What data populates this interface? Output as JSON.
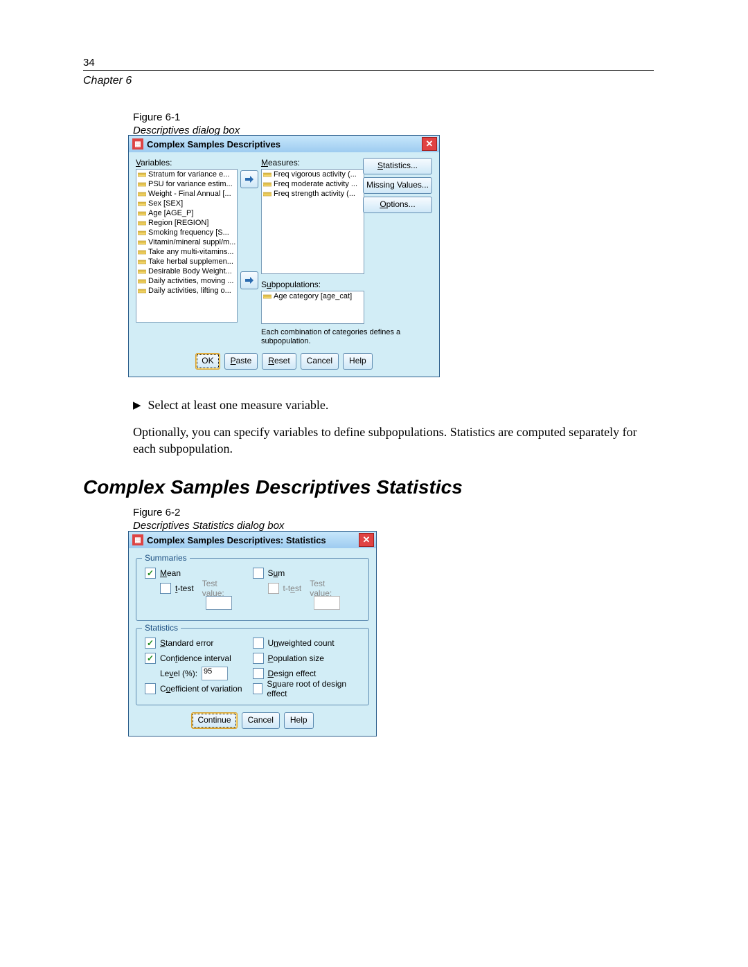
{
  "page_number": "34",
  "chapter": "Chapter 6",
  "figure1": {
    "label": "Figure 6-1",
    "caption": "Descriptives dialog box"
  },
  "dialog1": {
    "title": "Complex Samples Descriptives",
    "labels": {
      "variables": "Variables:",
      "measures": "Measures:",
      "subpop": "Subpopulations:"
    },
    "variables": [
      "Stratum for variance e...",
      "PSU for variance estim...",
      "Weight - Final Annual [...",
      "Sex [SEX]",
      "Age [AGE_P]",
      "Region [REGION]",
      "Smoking frequency [S...",
      "Vitamin/mineral suppl/m...",
      "Take any multi-vitamins...",
      "Take herbal supplemen...",
      "Desirable Body Weight...",
      "Daily activities, moving ...",
      "Daily activities, lifting o..."
    ],
    "measures": [
      "Freq vigorous activity (...",
      "Freq moderate activity ...",
      "Freq strength activity (..."
    ],
    "subpop": [
      "Age category [age_cat]"
    ],
    "side_buttons": {
      "stats": "Statistics...",
      "missing": "Missing Values...",
      "options": "Options..."
    },
    "hint": "Each combination of categories defines a subpopulation.",
    "buttons": {
      "ok": "OK",
      "paste": "Paste",
      "reset": "Reset",
      "cancel": "Cancel",
      "help": "Help"
    }
  },
  "body": {
    "bullet": "Select at least one measure variable.",
    "para": "Optionally, you can specify variables to define subpopulations. Statistics are computed separately for each subpopulation."
  },
  "heading": "Complex Samples Descriptives Statistics",
  "figure2": {
    "label": "Figure 6-2",
    "caption": "Descriptives Statistics dialog box"
  },
  "dialog2": {
    "title": "Complex Samples Descriptives: Statistics",
    "group_summaries": "Summaries",
    "group_statistics": "Statistics",
    "summaries": {
      "mean": "Mean",
      "sum": "Sum",
      "ttest": "t-test",
      "testvalue": "Test value:"
    },
    "stats": {
      "se": "Standard error",
      "unw": "Unweighted count",
      "ci": "Confidence interval",
      "pop": "Population size",
      "level_label": "Level (%):",
      "level_value": "95",
      "deff": "Design effect",
      "cv": "Coefficient of variation",
      "sqrt": "Square root of design effect"
    },
    "buttons": {
      "continue": "Continue",
      "cancel": "Cancel",
      "help": "Help"
    }
  }
}
